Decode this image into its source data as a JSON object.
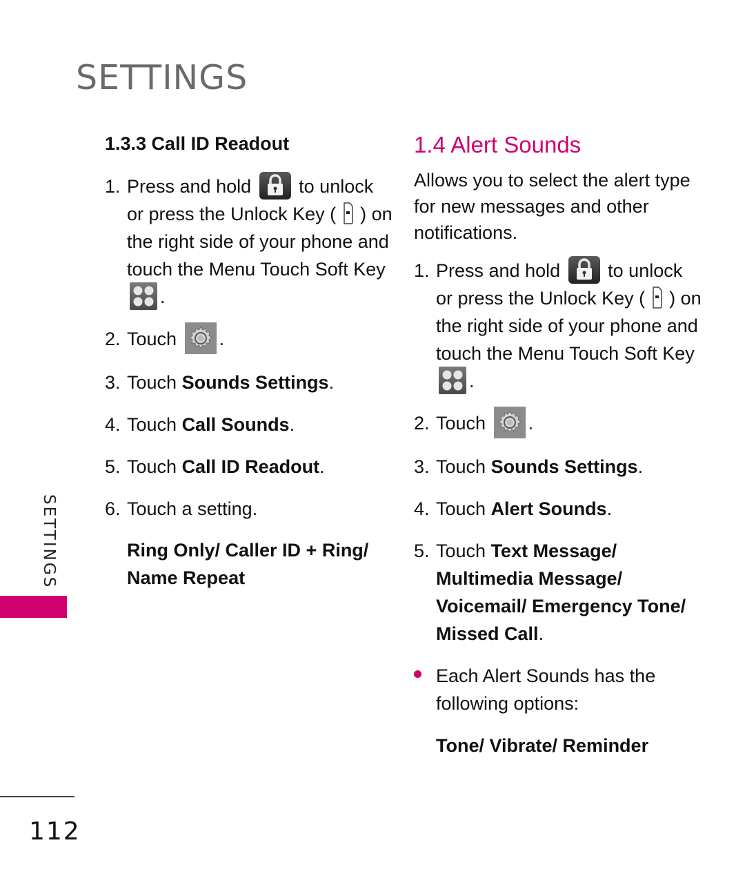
{
  "page": {
    "title": "SETTINGS",
    "side_label": "SETTINGS",
    "page_number": "112",
    "accent_color": "#d1006f"
  },
  "left": {
    "heading": "1.3.3 Call ID Readout",
    "steps": [
      {
        "num": "1.",
        "parts": {
          "a": "Press and hold",
          "lock_icon": "lock-icon",
          "b": "to unlock or press the Unlock Key (",
          "key_icon": "unlock-key-icon",
          "c": ") on the right side of your phone and touch the Menu Touch Soft Key",
          "menu_icon": "menu-icon",
          "d": "."
        }
      },
      {
        "num": "2.",
        "text": "Touch",
        "icon": "gear-icon",
        "after": "."
      },
      {
        "num": "3.",
        "text": "Touch ",
        "bold": "Sounds Settings",
        "after": "."
      },
      {
        "num": "4.",
        "text": "Touch ",
        "bold": "Call Sounds",
        "after": "."
      },
      {
        "num": "5.",
        "text": "Touch ",
        "bold": "Call ID Readout",
        "after": "."
      },
      {
        "num": "6.",
        "text": "Touch a setting."
      }
    ],
    "options": "Ring Only/ Caller ID + Ring/ Name Repeat"
  },
  "right": {
    "heading": "1.4 Alert Sounds",
    "intro": "Allows you to select the alert type for new messages and other notifications.",
    "steps": [
      {
        "num": "1.",
        "parts": {
          "a": "Press and hold",
          "b": "to unlock or press the Unlock Key (",
          "c": ") on the right side of your phone and touch the Menu Touch Soft Key",
          "d": "."
        }
      },
      {
        "num": "2.",
        "text": "Touch",
        "after": "."
      },
      {
        "num": "3.",
        "text": "Touch ",
        "bold": "Sounds Settings",
        "after": "."
      },
      {
        "num": "4.",
        "text": "Touch ",
        "bold": "Alert Sounds",
        "after": "."
      },
      {
        "num": "5.",
        "text": "Touch ",
        "bold": "Text Message/ Multimedia Message/ Voicemail/ Emergency Tone/ Missed Call",
        "after": "."
      }
    ],
    "bullet": "Each Alert Sounds has the following options:",
    "options": "Tone/ Vibrate/ Reminder"
  }
}
